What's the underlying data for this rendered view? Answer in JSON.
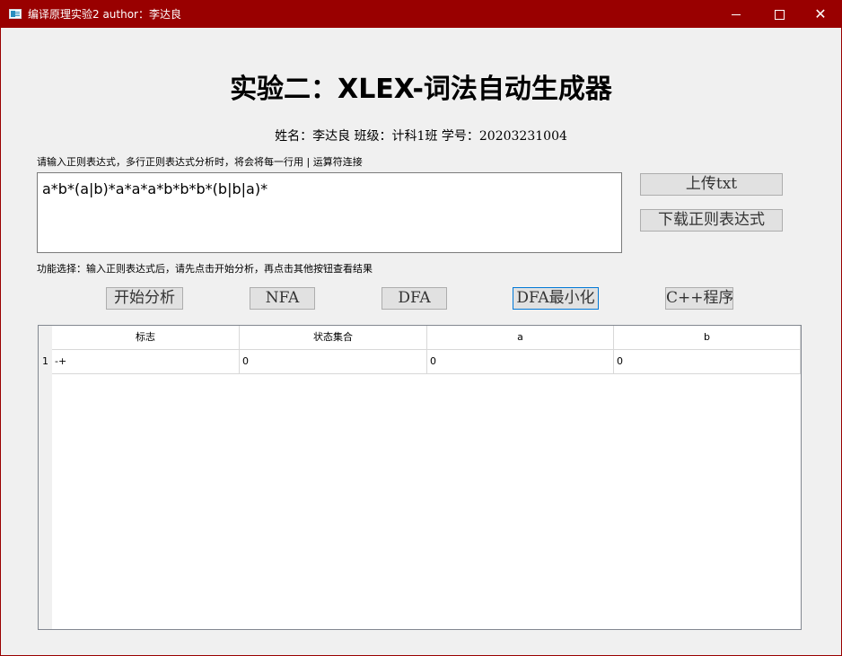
{
  "window": {
    "title": "编译原理实验2  author：李达良",
    "minimize": "—",
    "close": "✕"
  },
  "heading": "实验二：XLEX-词法自动生成器",
  "student_info": "姓名：李达良 班级：计科1班 学号：20203231004",
  "regex_hint": "请输入正则表达式，多行正则表达式分析时，将会将每一行用 | 运算符连接",
  "regex_value": "a*b*(a|b)*a*a*a*b*b*b*(b|b|a)*",
  "side_buttons": {
    "upload": "上传txt",
    "download": "下载正则表达式"
  },
  "function_hint": "功能选择：输入正则表达式后，请先点击开始分析，再点击其他按钮查看结果",
  "function_buttons": {
    "start": "开始分析",
    "nfa": "NFA",
    "dfa": "DFA",
    "dfa_min": "DFA最小化",
    "cpp": "C++程序"
  },
  "table": {
    "headers": [
      "标志",
      "状态集合",
      "a",
      "b"
    ],
    "rows": [
      {
        "num": "1",
        "cells": [
          "-+",
          "0",
          "0",
          "0"
        ]
      }
    ]
  },
  "colors": {
    "titlebar": "#990000",
    "background": "#f0f0f0",
    "focus_border": "#0078d7"
  },
  "icons": [
    "app-icon",
    "minimize-icon",
    "maximize-icon",
    "close-icon"
  ]
}
